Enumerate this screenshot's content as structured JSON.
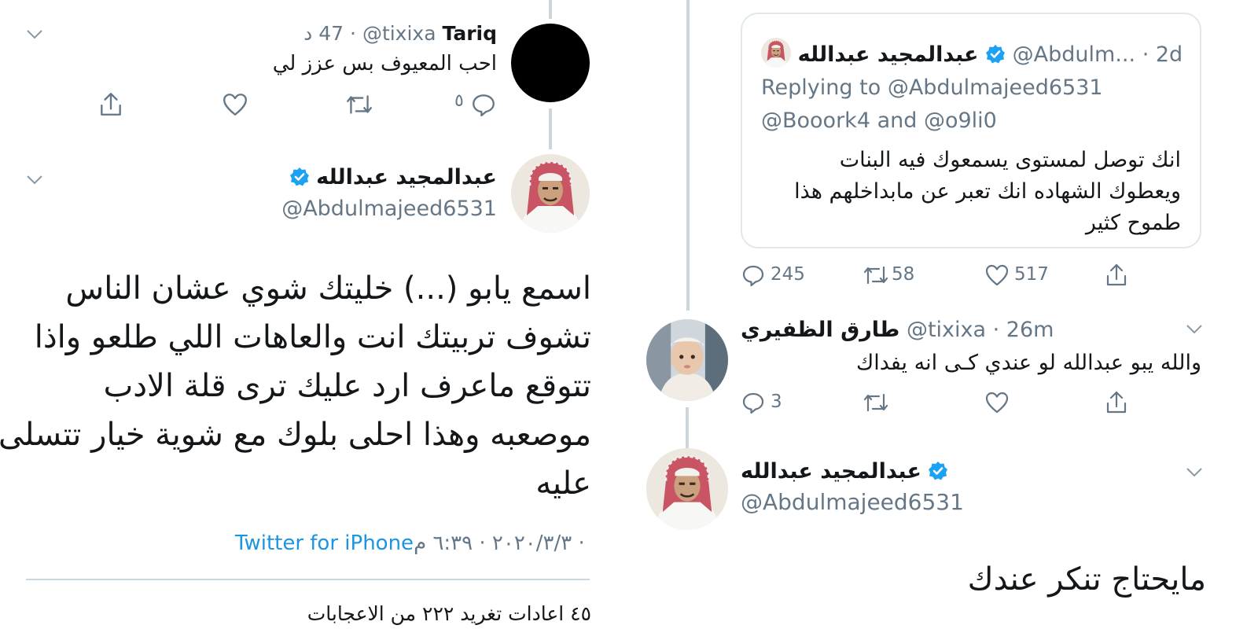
{
  "left": {
    "reply": {
      "name": "Tariq",
      "handle": "@tixixa",
      "dot": "·",
      "time": "47 د",
      "text": "احب المعيوف بس عزز لي",
      "reply_count": "٥"
    },
    "main": {
      "name": "عبدالمجيد عبدالله",
      "handle": "@Abdulmajeed6531",
      "text_lines": [
        "اسمع يابو (...) خليتك شوي عشان الناس",
        "تشوف تربيتك انت والعاهات اللي طلعو واذا",
        "تتوقع ماعرف ارد عليك ترى قلة الادب",
        "موصعبه وهذا احلى بلوك مع شوية خيار تتسلى",
        "عليه"
      ],
      "source": "Twitter for iPhone",
      "meta": " · ٢٠٢٠/٣/٣ · ٦:٣٩ م",
      "stats": "٤٥ اعادات تغريد  ٢٢٢ من الاعجابات"
    }
  },
  "right": {
    "quoted": {
      "name": "عبدالمجيد عبدالله",
      "handle": "@Abdulm...",
      "time": "· 2d",
      "replying_label": "Replying to",
      "replying_handle": "@Abdulmajeed6531",
      "others": "@Booork4 and @o9li0",
      "text_lines": [
        "انك توصل لمستوى يسمعوك فيه البنات",
        "ويعطوك الشهاده انك تعبر عن مابداخلهم هذا",
        "طموح كثير"
      ],
      "replies": "245",
      "retweets": "58",
      "likes": "517"
    },
    "reply": {
      "name": "طارق الظفيري",
      "handle": "@tixixa",
      "time": "· 26m",
      "text": "والله يبو عبدالله لو عندي كـى انه يفداك",
      "replies": "3"
    },
    "final": {
      "name": "عبدالمجيد عبدالله",
      "handle": "@Abdulmajeed6531",
      "text": "مايحتاج تنكر عندك"
    }
  },
  "colors": {
    "text": "#14171a",
    "secondary": "#657786",
    "link": "#1b95e0",
    "divider": "#ccd6dd",
    "verified": "#1da1f2"
  },
  "icons": [
    "chevron-down-icon",
    "reply-icon",
    "retweet-icon",
    "like-icon",
    "share-icon",
    "verified-badge-icon"
  ]
}
